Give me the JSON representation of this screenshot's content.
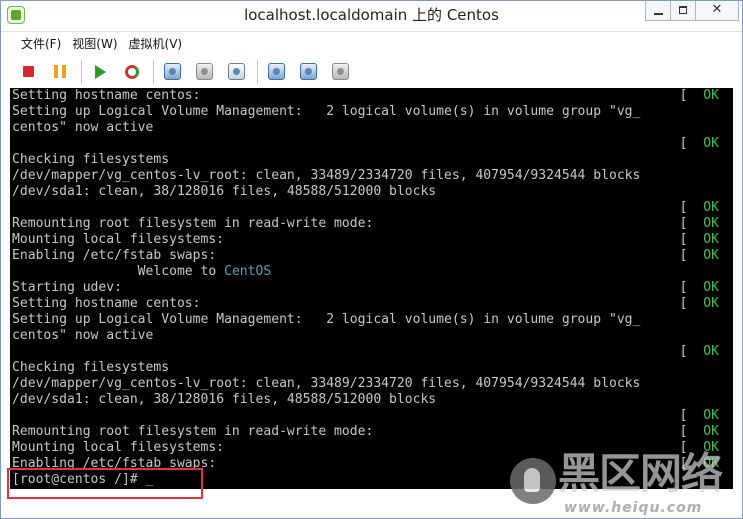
{
  "window": {
    "title": "localhost.localdomain 上的 Centos",
    "close_glyph": "✕"
  },
  "menu": [
    "文件(F)",
    "视图(W)",
    "虚拟机(V)"
  ],
  "toolbar": {
    "icons": [
      "stop-icon",
      "pause-icon",
      "play-icon",
      "reset-icon",
      "snapshot-icon",
      "revert-snapshot-icon",
      "manage-snapshots-icon",
      "disconnect-drive-icon",
      "connect-network-icon",
      "settings-icon"
    ]
  },
  "console": {
    "ok_text": "OK",
    "lines": [
      {
        "t": "Setting hostname centos:",
        "ok": true
      },
      {
        "t": "Setting up Logical Volume Management:   2 logical volume(s) in volume group \"vg_"
      },
      {
        "t": "centos\" now active"
      },
      {
        "t": "",
        "ok": true
      },
      {
        "t": "Checking filesystems"
      },
      {
        "t": "/dev/mapper/vg_centos-lv_root: clean, 33489/2334720 files, 407954/9324544 blocks"
      },
      {
        "t": "/dev/sda1: clean, 38/128016 files, 48588/512000 blocks"
      },
      {
        "t": "",
        "ok": true
      },
      {
        "t": "Remounting root filesystem in read-write mode:",
        "ok": true
      },
      {
        "t": "Mounting local filesystems:",
        "ok": true
      },
      {
        "t": "Enabling /etc/fstab swaps:",
        "ok": true
      },
      {
        "t": "                Welcome to ",
        "hl": "CentOS"
      },
      {
        "t": "Starting udev:",
        "ok": true
      },
      {
        "t": "Setting hostname centos:",
        "ok": true
      },
      {
        "t": "Setting up Logical Volume Management:   2 logical volume(s) in volume group \"vg_"
      },
      {
        "t": "centos\" now active"
      },
      {
        "t": "",
        "ok": true
      },
      {
        "t": "Checking filesystems"
      },
      {
        "t": "/dev/mapper/vg_centos-lv_root: clean, 33489/2334720 files, 407954/9324544 blocks"
      },
      {
        "t": "/dev/sda1: clean, 38/128016 files, 48588/512000 blocks"
      },
      {
        "t": "",
        "ok": true
      },
      {
        "t": "Remounting root filesystem in read-write mode:",
        "ok": true
      },
      {
        "t": "Mounting local filesystems:",
        "ok": true
      },
      {
        "t": "Enabling /etc/fstab swaps:",
        "ok": true
      },
      {
        "t": "[root@centos /]# _"
      }
    ]
  },
  "watermark": {
    "main": "黑区网络",
    "sub": "www.heiqu.com"
  }
}
